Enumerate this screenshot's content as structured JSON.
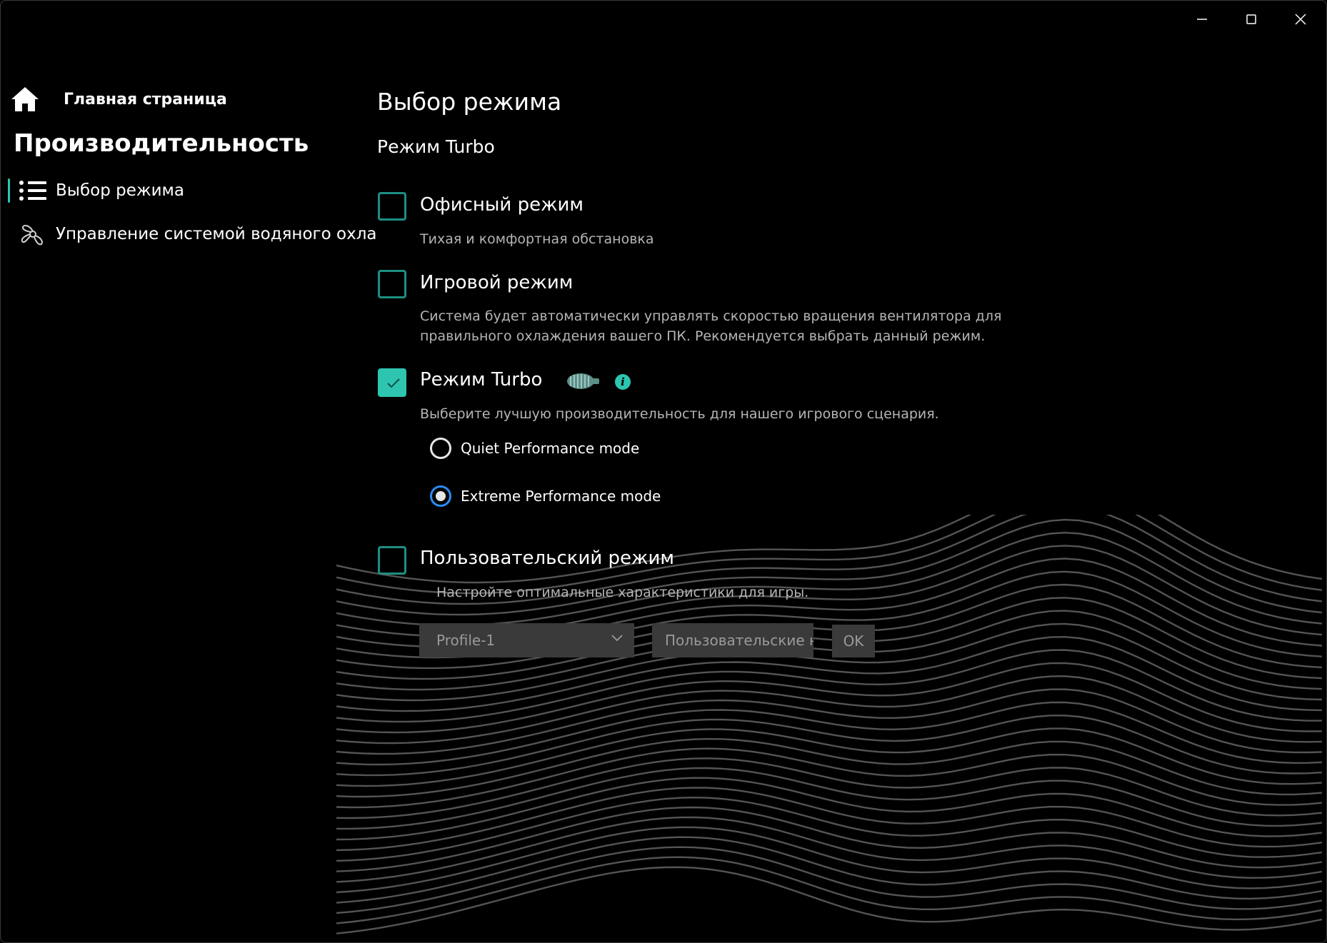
{
  "window": {
    "controls": [
      "minimize",
      "maximize",
      "close"
    ]
  },
  "sidebar": {
    "home_label": "Главная страница",
    "section_title": "Производительность",
    "items": [
      {
        "label": "Выбор режима",
        "icon": "list-icon",
        "active": true
      },
      {
        "label": "Управление системой водяного охла",
        "icon": "fan-icon",
        "active": false
      }
    ]
  },
  "main": {
    "title": "Выбор режима",
    "subtitle": "Режим Turbo",
    "options": [
      {
        "label": "Офисный режим",
        "desc": "Тихая и комфортная обстановка",
        "checked": false
      },
      {
        "label": "Игровой режим",
        "desc_lines": [
          "Система будет автоматически управлять скоростью вращения вентилятора для",
          "правильного охлаждения вашего ПК. Рекомендуется выбрать данный режим."
        ],
        "checked": false
      },
      {
        "label": "Режим Turbo",
        "desc": "Выберите лучшую производительность для нашего игрового сценария.",
        "checked": true
      },
      {
        "label": "Пользовательский режим",
        "desc": "Настройте оптимальные характеристики для игры.",
        "checked": false
      }
    ],
    "turbo_modes": [
      {
        "label": "Quiet Performance mode",
        "selected": false
      },
      {
        "label": "Extreme Performance mode",
        "selected": true
      }
    ],
    "custom": {
      "profile_value": "Profile-1",
      "settings_value": "Пользовательские на",
      "ok_label": "OK"
    }
  },
  "colors": {
    "accent": "#2dc5b0",
    "checkbox_border": "#1d8f83",
    "radio_selected": "#2a8cf0",
    "background": "#000000",
    "disabled_bg": "#3a3a3a"
  }
}
